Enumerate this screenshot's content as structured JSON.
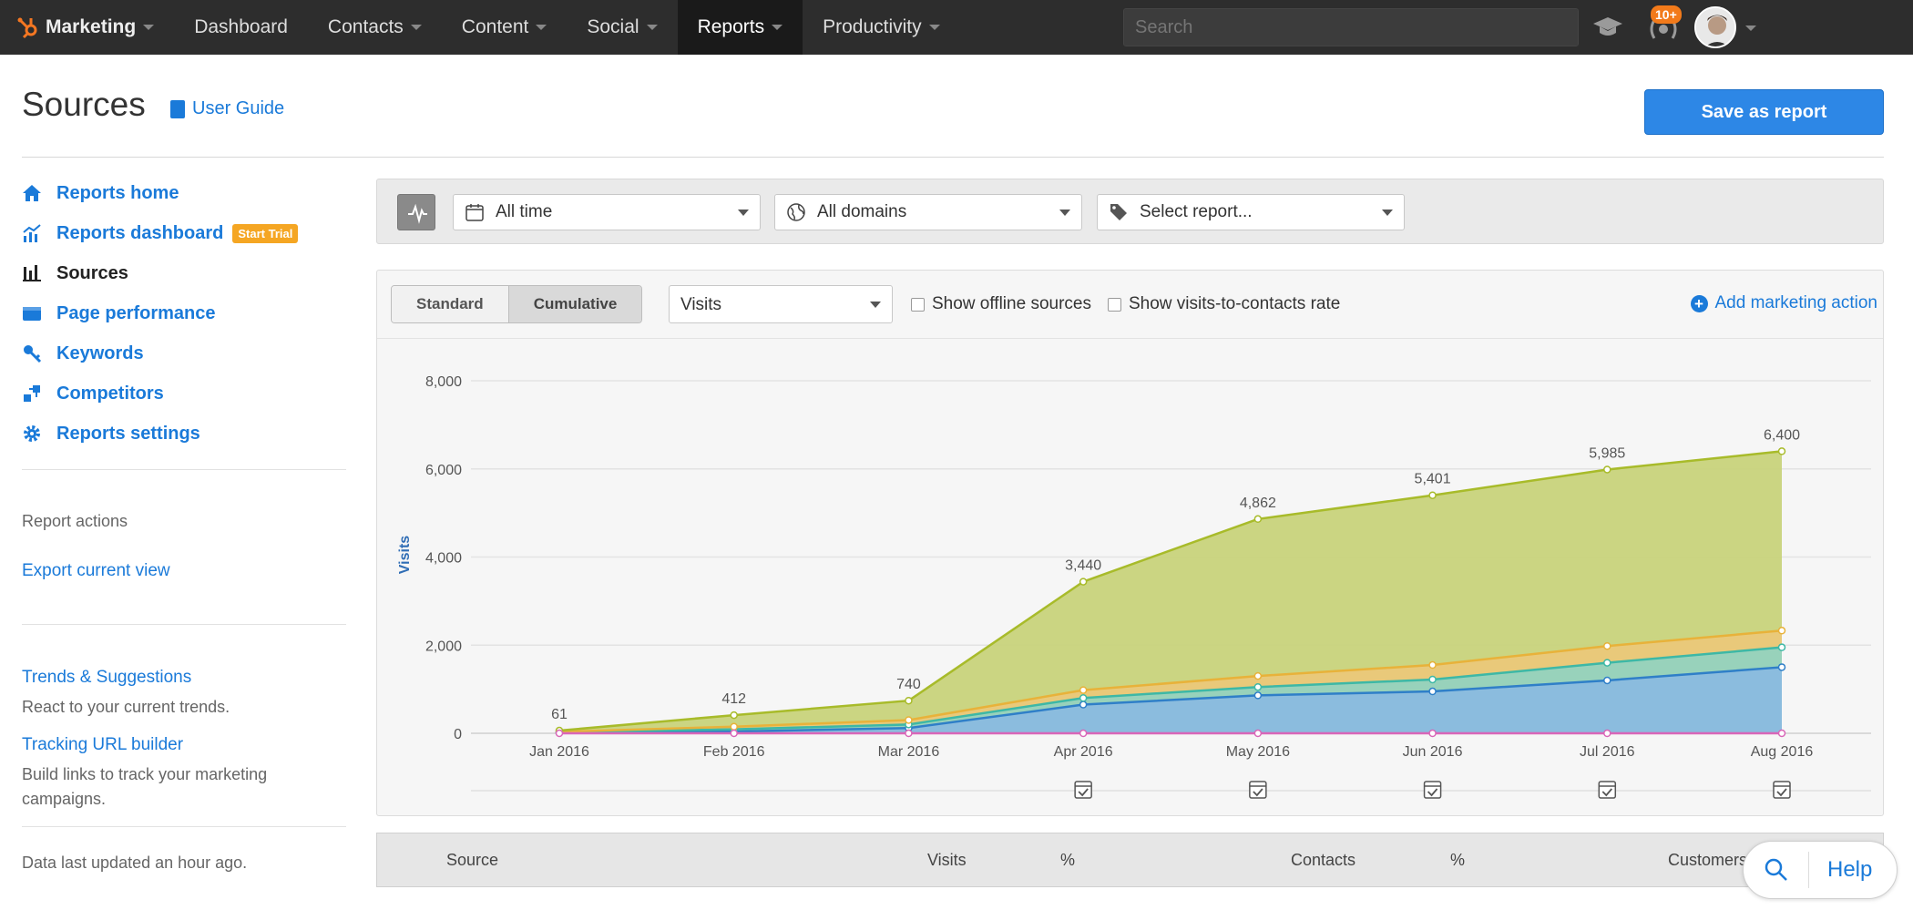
{
  "nav": {
    "brand": "Marketing",
    "items": [
      "Dashboard",
      "Contacts",
      "Content",
      "Social",
      "Reports",
      "Productivity"
    ],
    "active": "Reports",
    "search_placeholder": "Search",
    "notif_badge": "10+"
  },
  "header": {
    "title": "Sources",
    "user_guide": "User Guide",
    "save_button": "Save as report"
  },
  "sidebar": {
    "items": [
      {
        "label": "Reports home",
        "icon": "home-icon"
      },
      {
        "label": "Reports dashboard",
        "icon": "dashboard-icon",
        "badge": "Start Trial"
      },
      {
        "label": "Sources",
        "icon": "bar-chart-icon",
        "current": true
      },
      {
        "label": "Page performance",
        "icon": "page-icon"
      },
      {
        "label": "Keywords",
        "icon": "key-icon"
      },
      {
        "label": "Competitors",
        "icon": "competitors-icon"
      },
      {
        "label": "Reports settings",
        "icon": "gear-icon"
      }
    ],
    "report_actions_label": "Report actions",
    "export_link": "Export current view",
    "trends_link": "Trends & Suggestions",
    "trends_desc": "React to your current trends.",
    "tracking_link": "Tracking URL builder",
    "tracking_desc": "Build links to track your marketing campaigns.",
    "updated": "Data last updated an hour ago."
  },
  "filters": {
    "time": "All time",
    "domains": "All domains",
    "report": "Select report..."
  },
  "controls": {
    "standard": "Standard",
    "cumulative": "Cumulative",
    "metric": "Visits",
    "offline": "Show offline sources",
    "rate": "Show visits-to-contacts rate",
    "add_action": "Add marketing action"
  },
  "table": {
    "headers": [
      "Source",
      "Visits",
      "%",
      "Contacts",
      "%",
      "Customers"
    ]
  },
  "help": {
    "label": "Help"
  },
  "colors": {
    "olive": "#a8bb2a",
    "olive_fill": "#c7d275",
    "orange": "#e8b23a",
    "orange_fill": "#ecc879",
    "teal": "#3db8a6",
    "teal_fill": "#8fd3c2",
    "blue": "#2f7fc8",
    "blue_fill": "#8ab9e2",
    "pink": "#d966b8"
  },
  "chart_data": {
    "type": "area",
    "ylabel": "Visits",
    "ylim": [
      0,
      8000
    ],
    "yticks": [
      "0",
      "2,000",
      "4,000",
      "6,000",
      "8,000"
    ],
    "categories": [
      "Jan 2016",
      "Feb 2016",
      "Mar 2016",
      "Apr 2016",
      "May 2016",
      "Jun 2016",
      "Jul 2016",
      "Aug 2016"
    ],
    "total_labels": [
      "61",
      "412",
      "740",
      "3,440",
      "4,862",
      "5,401",
      "5,985",
      "6,400"
    ],
    "series": [
      {
        "values": [
          10,
          40,
          120,
          650,
          860,
          950,
          1200,
          1500
        ],
        "color": "blue"
      },
      {
        "values": [
          20,
          90,
          200,
          800,
          1050,
          1220,
          1600,
          1950
        ],
        "color": "teal"
      },
      {
        "values": [
          35,
          150,
          300,
          980,
          1300,
          1550,
          1980,
          2330
        ],
        "color": "orange"
      },
      {
        "values": [
          61,
          412,
          740,
          3440,
          4862,
          5401,
          5985,
          6400
        ],
        "color": "olive"
      },
      {
        "values": [
          0,
          0,
          0,
          0,
          0,
          0,
          0,
          0
        ],
        "color": "pink"
      }
    ],
    "action_markers": [
      "Apr 2016",
      "May 2016",
      "Jun 2016",
      "Jul 2016",
      "Aug 2016"
    ]
  }
}
